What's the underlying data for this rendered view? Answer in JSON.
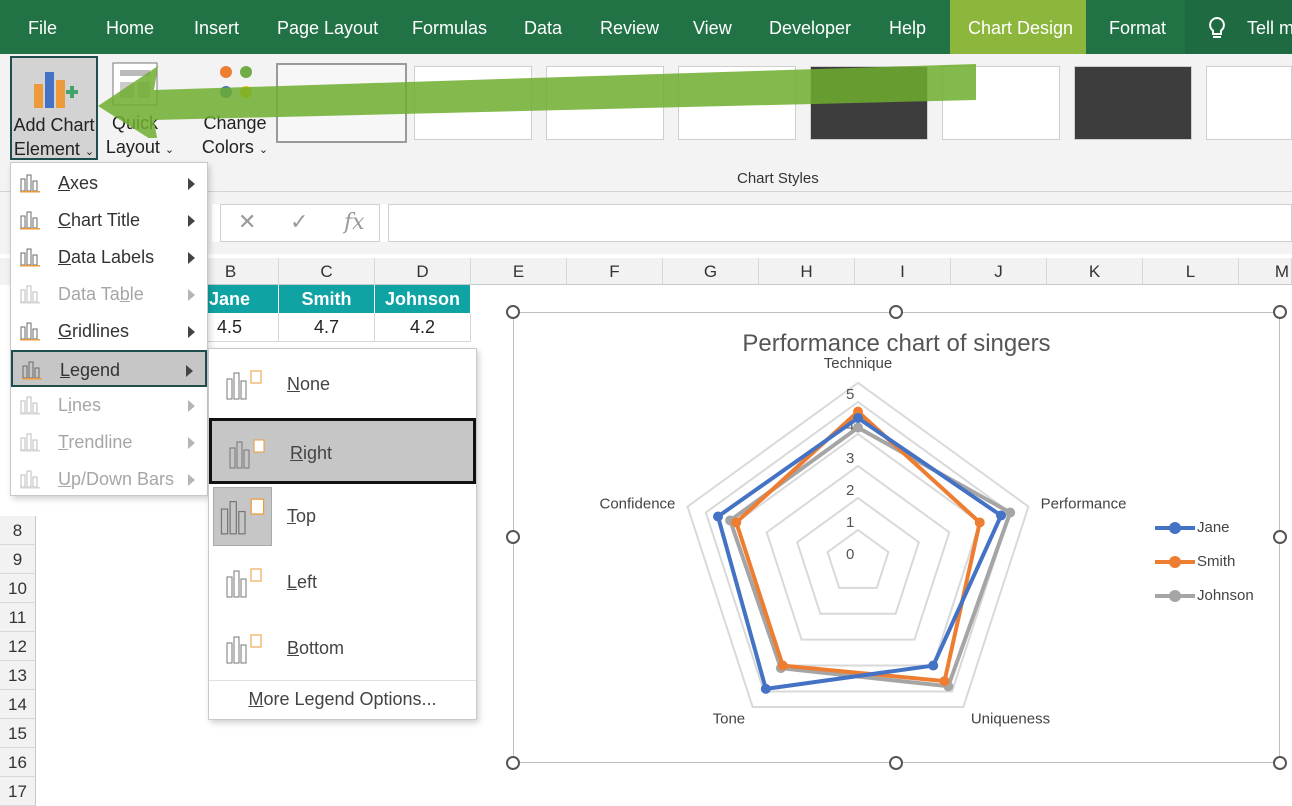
{
  "ribbon_tabs": [
    "File",
    "Home",
    "Insert",
    "Page Layout",
    "Formulas",
    "Data",
    "Review",
    "View",
    "Developer",
    "Help",
    "Chart Design",
    "Format"
  ],
  "tell_me": "Tell m",
  "ribbon": {
    "add_chart_element": {
      "line1": "Add Chart",
      "line2": "Element"
    },
    "quick_layout": {
      "line1": "Quick",
      "line2": "Layout"
    },
    "change_colors": {
      "line1": "Change",
      "line2": "Colors"
    },
    "chart_styles_label": "Chart Styles"
  },
  "formula_bar": {
    "cancel": "✕",
    "enter": "✓",
    "fx": "fx",
    "value": ""
  },
  "columns": [
    "B",
    "C",
    "D",
    "E",
    "F",
    "G",
    "H",
    "I",
    "J",
    "K",
    "L",
    "M"
  ],
  "rows": [
    "8",
    "9",
    "10",
    "11",
    "12",
    "13",
    "14",
    "15",
    "16",
    "17"
  ],
  "table": {
    "headers": [
      "Jane",
      "Smith",
      "Johnson"
    ],
    "values": [
      "4.5",
      "4.7",
      "4.2"
    ]
  },
  "add_chart_element_menu": [
    {
      "label": "Axes",
      "mnemonic": "A",
      "enabled": true
    },
    {
      "label": "Chart Title",
      "mnemonic": "C",
      "enabled": true
    },
    {
      "label": "Data Labels",
      "mnemonic": "D",
      "enabled": true
    },
    {
      "label": "Data Table",
      "mnemonic": "b",
      "enabled": false
    },
    {
      "label": "Gridlines",
      "mnemonic": "G",
      "enabled": true
    },
    {
      "label": "Legend",
      "mnemonic": "L",
      "enabled": true,
      "highlighted": true
    },
    {
      "label": "Lines",
      "mnemonic": "i",
      "enabled": false
    },
    {
      "label": "Trendline",
      "mnemonic": "T",
      "enabled": false
    },
    {
      "label": "Up/Down Bars",
      "mnemonic": "U",
      "enabled": false
    }
  ],
  "legend_submenu": {
    "items": [
      {
        "label": "None",
        "mnemonic": "N"
      },
      {
        "label": "Right",
        "mnemonic": "R",
        "highlighted": true
      },
      {
        "label": "Top",
        "mnemonic": "T",
        "selected": true
      },
      {
        "label": "Left",
        "mnemonic": "L"
      },
      {
        "label": "Bottom",
        "mnemonic": "B"
      }
    ],
    "more_options": "More Legend Options..."
  },
  "chart_data": {
    "type": "radar",
    "title": "Performance chart of singers",
    "categories": [
      "Technique",
      "Performance",
      "Uniqueness",
      "Tone",
      "Confidence"
    ],
    "axis_ticks": [
      "0",
      "1",
      "2",
      "3",
      "4",
      "5"
    ],
    "rlim": [
      0,
      5
    ],
    "series": [
      {
        "name": "Jane",
        "color": "#4472c4",
        "values": [
          4.5,
          4.7,
          4.0,
          4.9,
          4.6
        ]
      },
      {
        "name": "Smith",
        "color": "#ed7d31",
        "values": [
          4.7,
          4.0,
          4.6,
          4.0,
          4.0
        ]
      },
      {
        "name": "Johnson",
        "color": "#a5a5a5",
        "values": [
          4.2,
          5.0,
          4.8,
          4.1,
          4.2
        ]
      }
    ],
    "legend_position": "right",
    "grid": true
  },
  "colors": {
    "excel_green": "#217346",
    "chart_design_tab": "#8cb63c",
    "header_teal": "#0fa3a3"
  }
}
